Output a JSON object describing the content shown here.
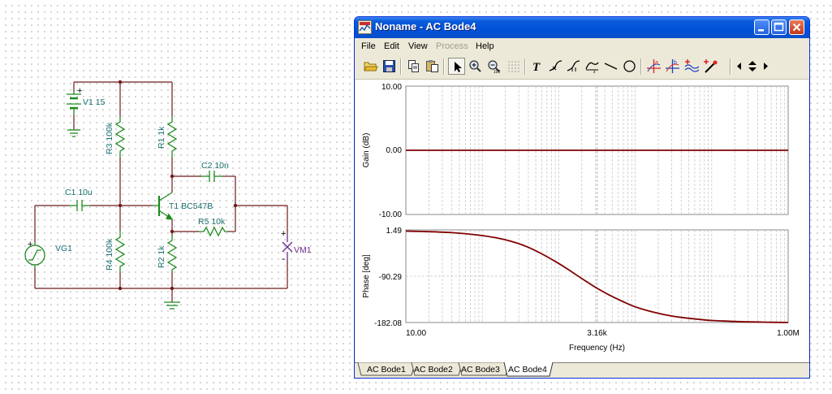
{
  "schematic": {
    "components": {
      "v1": "V1 15",
      "r3": "R3 100k",
      "r1": "R1 1k",
      "c2": "C2 10n",
      "c1": "C1 10u",
      "t1": "T1 BC547B",
      "r5": "R5 10k",
      "vg1": "VG1",
      "vm1": "VM1",
      "r4": "R4 100k",
      "r2": "R2 1k"
    },
    "plus": "+",
    "minus": "-",
    "colors": {
      "wire": "#6e1a1a",
      "component": "#1f8a1f",
      "label": "#1a6f6f",
      "meter": "#6a2a8a"
    }
  },
  "window": {
    "title": "Noname - AC Bode4",
    "menu": [
      {
        "label": "File",
        "enabled": true
      },
      {
        "label": "Edit",
        "enabled": true
      },
      {
        "label": "View",
        "enabled": true
      },
      {
        "label": "Process",
        "enabled": false
      },
      {
        "label": "Help",
        "enabled": true
      }
    ],
    "toolbar": [
      "open-icon",
      "save-icon",
      "copy-icon",
      "paste-icon",
      "pointer-icon",
      "zoom-in-icon",
      "zoom-out-icon",
      "grid-icon",
      "text-icon",
      "curve-a-icon",
      "curve-b-icon",
      "curve-c-icon",
      "line-icon",
      "circle-icon",
      "cursor-a-icon",
      "cursor-b-icon",
      "wave-cursor-icon",
      "probe-icon",
      "arrow-left-icon",
      "arrow-updown-icon",
      "arrow-right-icon"
    ],
    "tabs": [
      "AC Bode1",
      "AC Bode2",
      "AC Bode3",
      "AC Bode4"
    ],
    "active_tab": "AC Bode4"
  },
  "chart_data": [
    {
      "type": "line",
      "ylabel": "Gain (dB)",
      "xscale": "log",
      "xlim": [
        10,
        1000000
      ],
      "ylim": [
        -10,
        10
      ],
      "yticks": [
        "10.00",
        "0.00",
        "-10.00"
      ],
      "grid": true,
      "series": [
        {
          "color": "#800000",
          "x": [
            10,
            1000000
          ],
          "y": [
            0,
            0
          ]
        }
      ]
    },
    {
      "type": "line",
      "ylabel": "Phase [deg]",
      "xlabel": "Frequency (Hz)",
      "xscale": "log",
      "xlim": [
        10,
        1000000
      ],
      "ylim": [
        -182.08,
        1.49
      ],
      "yticks": [
        "1.49",
        "-90.29",
        "-182.08"
      ],
      "xticks": [
        "10.00",
        "3.16k",
        "1.00M"
      ],
      "grid": true,
      "series": [
        {
          "color": "#800000",
          "x": [
            10,
            20,
            40,
            80,
            150,
            250,
            400,
            600,
            900,
            1300,
            2000,
            3000,
            4500,
            7000,
            10000,
            15000,
            25000,
            40000,
            70000,
            100000,
            200000,
            500000,
            1000000
          ],
          "y": [
            -1,
            -2,
            -4,
            -8,
            -14,
            -22,
            -33,
            -46,
            -61,
            -76,
            -95,
            -112,
            -127,
            -141,
            -151,
            -159,
            -167,
            -172,
            -176,
            -178,
            -180,
            -181.5,
            -182
          ]
        }
      ]
    }
  ]
}
